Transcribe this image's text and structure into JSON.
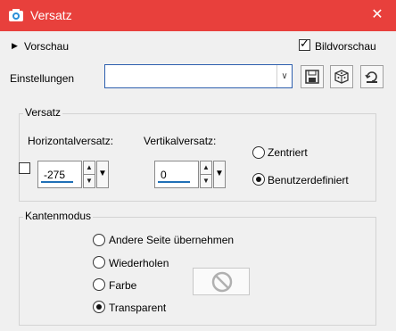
{
  "window": {
    "title": "Versatz",
    "close_glyph": "✕",
    "icon": "camera-icon"
  },
  "preview": {
    "toggle_glyph": "▶",
    "label": "Vorschau",
    "checkbox_label": "Bildvorschau",
    "checkbox_checked": true
  },
  "settings": {
    "label": "Einstellungen",
    "value": "",
    "dropdown_glyph": "∨"
  },
  "toolbar": {
    "save_icon": "save-icon",
    "random_icon": "dice-icon",
    "reset_icon": "reset-icon"
  },
  "offset_group": {
    "title": "Versatz",
    "horizontal_label": "Horizontalversatz:",
    "horizontal_value": "-275",
    "vertical_label": "Vertikalversatz:",
    "vertical_value": "0",
    "link_checkbox_checked": false,
    "options": [
      {
        "label": "Zentriert",
        "selected": false
      },
      {
        "label": "Benutzerdefiniert",
        "selected": true
      }
    ]
  },
  "edge_group": {
    "title": "Kantenmodus",
    "options": [
      {
        "label": "Andere Seite übernehmen",
        "selected": false
      },
      {
        "label": "Wiederholen",
        "selected": false
      },
      {
        "label": "Farbe",
        "selected": false
      },
      {
        "label": "Transparent",
        "selected": true
      }
    ],
    "color_swatch_icon": "no-color-icon"
  },
  "colors": {
    "titlebar": "#e8403c",
    "accent": "#1f6fb6"
  }
}
